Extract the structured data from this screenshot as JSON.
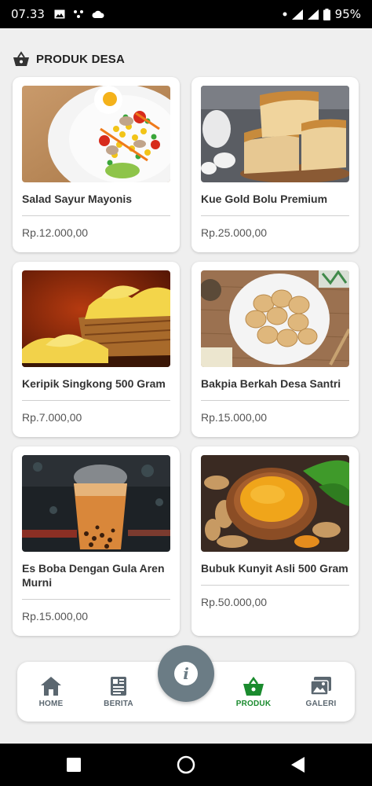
{
  "status_bar": {
    "time": "07.33",
    "battery": "95%",
    "icons": [
      "image-icon",
      "dots-icon",
      "cloud-icon",
      "dot-icon",
      "wifi-icon",
      "signal-icon",
      "battery-icon"
    ]
  },
  "header": {
    "title": "PRODUK DESA",
    "icon": "basket-icon"
  },
  "products": [
    {
      "name": "Salad Sayur Mayonis",
      "price": "Rp.12.000,00",
      "image": "salad"
    },
    {
      "name": "Kue Gold Bolu Premium",
      "price": "Rp.25.000,00",
      "image": "cake"
    },
    {
      "name": "Keripik Singkong 500 Gram",
      "price": "Rp.7.000,00",
      "image": "chips"
    },
    {
      "name": "Bakpia Berkah Desa Santri",
      "price": "Rp.15.000,00",
      "image": "bakpia"
    },
    {
      "name": "Es Boba Dengan Gula Aren Murni",
      "price": "Rp.15.000,00",
      "image": "boba"
    },
    {
      "name": "Bubuk Kunyit Asli 500 Gram",
      "price": "Rp.50.000,00",
      "image": "turmeric"
    }
  ],
  "bottom_nav": {
    "items": [
      {
        "label": "HOME",
        "icon": "home-icon"
      },
      {
        "label": "BERITA",
        "icon": "newspaper-icon"
      },
      {
        "label": "PRODUK",
        "icon": "basket-icon",
        "active": true
      },
      {
        "label": "GALERI",
        "icon": "gallery-icon"
      }
    ],
    "fab_icon": "info-icon",
    "active_color": "#1a8b2e",
    "inactive_color": "#5b6770"
  },
  "system_nav": [
    "recents-button",
    "home-button",
    "back-button"
  ]
}
